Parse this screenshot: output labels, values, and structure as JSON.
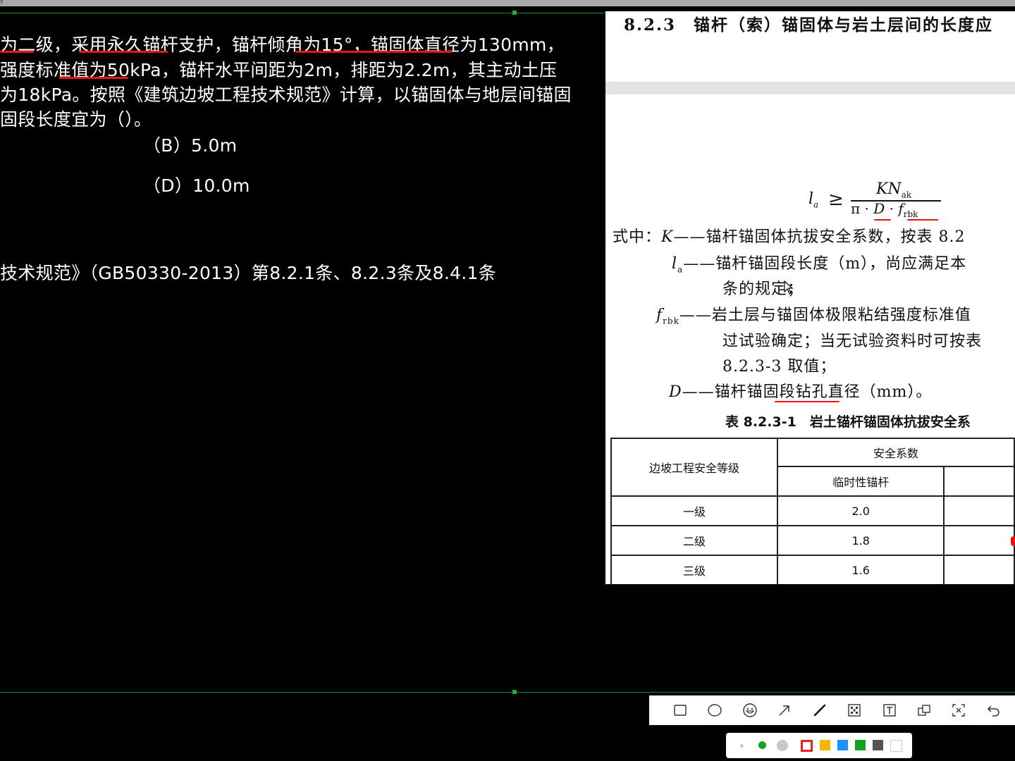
{
  "window": {
    "top_glyph": "y"
  },
  "question": {
    "lines": [
      "为二级，采用永久锚杆支护，锚杆倾角为15°，锚固体直径为130mm，",
      "强度标准值为50kPa，锚杆水平间距为2m，排距为2.2m，其主动土压",
      "为18kPa。按照《建筑边坡工程技术规范》计算，以锚固体与地层间锚固",
      "固段长度宜为（）。"
    ],
    "option_b": "（B）5.0m",
    "option_d": "（D）10.0m",
    "reference": "技术规范》（GB50330-2013）第8.2.1条、8.2.3条及8.4.1条"
  },
  "document": {
    "heading": "8.2.3　锚杆（索）锚固体与岩土层间的长度应",
    "formula": {
      "la": "l",
      "la_sub": "a",
      "geq": "≥",
      "numerator": "KN",
      "num_sub": "ak",
      "pi": "π",
      "dot": "·",
      "D": "D",
      "f": "f",
      "f_sub": "rbk"
    },
    "definitions": [
      {
        "prefix": "式中：",
        "symbol": "K",
        "sub": "",
        "text": "——锚杆锚固体抗拔安全系数，按表 8.2"
      },
      {
        "prefix": "",
        "symbol": "l",
        "sub": "a",
        "text": "——锚杆锚固段长度（m），尚应满足本"
      },
      {
        "prefix": "",
        "symbol": "",
        "sub": "",
        "text": "条的规定；"
      },
      {
        "prefix": "",
        "symbol": "f",
        "sub": "rbk",
        "text": "——岩土层与锚固体极限粘结强度标准值"
      },
      {
        "prefix": "",
        "symbol": "",
        "sub": "",
        "text": "过试验确定；当无试验资料时可按表"
      },
      {
        "prefix": "",
        "symbol": "",
        "sub": "",
        "text": "8.2.3-3 取值；"
      },
      {
        "prefix": "",
        "symbol": "D",
        "sub": "",
        "text": "——锚杆锚固段钻孔直径（mm）。"
      }
    ],
    "table_title": "表 8.2.3-1　岩土锚杆锚固体抗拔安全系",
    "table": {
      "header_left": "边坡工程安全等级",
      "header_group": "安全系数",
      "sub_header": "临时性锚杆",
      "rows": [
        {
          "grade": "一级",
          "temp": "2.0"
        },
        {
          "grade": "二级",
          "temp": "1.8"
        },
        {
          "grade": "三级",
          "temp": "1.6"
        }
      ]
    }
  },
  "toolbar": {
    "tools": [
      "rectangle-icon",
      "ellipse-icon",
      "emoji-icon",
      "arrow-icon",
      "pen-icon",
      "mosaic-icon",
      "text-icon",
      "sequence-icon",
      "screenshot-icon",
      "undo-icon"
    ],
    "active_tool": "pen-icon"
  },
  "palette": {
    "sizes": [
      "small",
      "medium",
      "large"
    ],
    "selected_size": "medium",
    "colors": [
      "#e32222",
      "#f5b800",
      "#1e90ff",
      "#11a321",
      "#555555",
      "#ffffff"
    ],
    "selected_color": "#e32222"
  },
  "colors": {
    "annotation_red": "#e11111",
    "guide_green": "#0a8f1e"
  }
}
